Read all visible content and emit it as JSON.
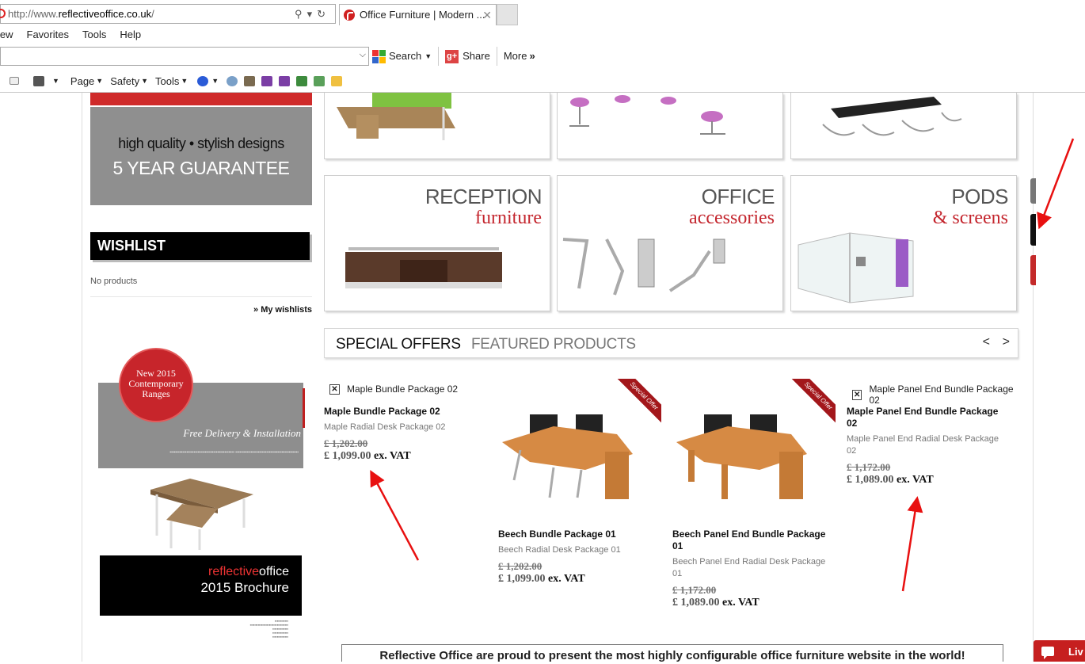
{
  "browser": {
    "url_prefix": "http://www.",
    "url_domain": "reflectiveoffice.co.uk",
    "url_suffix": "/",
    "tab_title": "Office Furniture | Modern ...",
    "menu": [
      "iew",
      "Favorites",
      "Tools",
      "Help"
    ],
    "toolbar": {
      "search_label": "Search",
      "share_label": "Share",
      "more_label": "More"
    },
    "commands": {
      "page_label": "Page",
      "safety_label": "Safety",
      "tools_label": "Tools"
    }
  },
  "sidebar": {
    "guarantee_line1": "high quality • stylish designs",
    "guarantee_line2": "5 YEAR GUARANTEE",
    "wishlist_title": "WISHLIST",
    "wishlist_empty": "No products",
    "wishlist_link": "» My wishlists",
    "promo_badge": "New 2015 Contemporary Ranges",
    "promo_delivery": "Free Delivery & Installation",
    "brochure_brand_a": "reflective",
    "brochure_brand_b": "office",
    "brochure_year": "2015 Brochure"
  },
  "categories": [
    {
      "title": "RECEPTION",
      "subtitle": "furniture"
    },
    {
      "title": "OFFICE",
      "subtitle": "accessories"
    },
    {
      "title": "PODS",
      "subtitle": "& screens"
    }
  ],
  "offers": {
    "tab_special": "SPECIAL OFFERS",
    "tab_featured": "FEATURED PRODUCTS",
    "prev": "<",
    "next": ">",
    "ribbon": "Special Offer",
    "products": [
      {
        "image_alt": "Maple Bundle Package 02",
        "name": "Maple Bundle Package 02",
        "desc": "Maple Radial Desk Package 02",
        "old_price": "£ 1,202.00",
        "new_price": "£ 1,099.00",
        "vat": "ex. VAT"
      },
      {
        "name": "Beech Bundle Package 01",
        "desc": "Beech Radial Desk Package 01",
        "old_price": "£ 1,202.00",
        "new_price": "£ 1,099.00",
        "vat": "ex. VAT"
      },
      {
        "name": "Beech Panel End Bundle Package 01",
        "desc": "Beech Panel End Radial Desk Package 01",
        "old_price": "£ 1,172.00",
        "new_price": "£ 1,089.00",
        "vat": "ex. VAT"
      },
      {
        "image_alt": "Maple Panel End Bundle Package 02",
        "name": "Maple Panel End Bundle Package 02",
        "desc": "Maple Panel End Radial Desk Package 02",
        "old_price": "£ 1,172.00",
        "new_price": "£ 1,089.00",
        "vat": "ex. VAT"
      }
    ]
  },
  "statement": "Reflective Office are proud to present the most highly configurable office furniture website in the world!",
  "live_chat": "Liv",
  "colors": {
    "brand_red": "#c4262e",
    "annotation_red": "#e81010"
  }
}
